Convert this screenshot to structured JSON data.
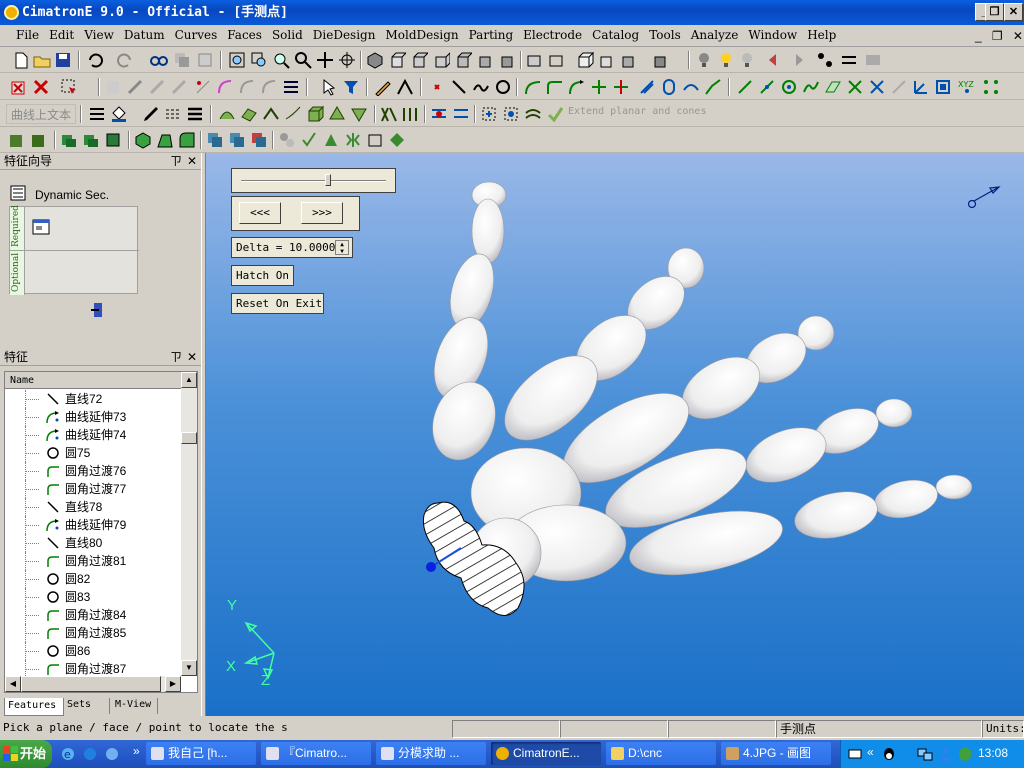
{
  "window": {
    "title": "CimatronE 9.0 - Official - [手测点]",
    "controls": [
      "_",
      "❐",
      "✕"
    ],
    "doc_controls": [
      "_",
      "❐",
      "✕"
    ]
  },
  "menu": [
    "File",
    "Edit",
    "View",
    "Datum",
    "Curves",
    "Faces",
    "Solid",
    "DieDesign",
    "MoldDesign",
    "Parting",
    "Electrode",
    "Catalog",
    "Tools",
    "Analyze",
    "Window",
    "Help"
  ],
  "toolbar3": {
    "text_button": "曲线上文本",
    "disabled_label": "Extend planar and cones"
  },
  "feature_guide": {
    "header": "特征向导",
    "pin": "ㄗ",
    "close": "✕",
    "title": "Dynamic Sec.",
    "required": "Required",
    "optional": "Optional"
  },
  "features_panel": {
    "header": "特征",
    "pin": "ㄗ",
    "close": "✕",
    "column": "Name",
    "items": [
      {
        "icon": "line",
        "label": "直线72"
      },
      {
        "icon": "extend",
        "label": "曲线延伸73"
      },
      {
        "icon": "extend",
        "label": "曲线延伸74"
      },
      {
        "icon": "circle",
        "label": "圆75"
      },
      {
        "icon": "fillet",
        "label": "圆角过渡76"
      },
      {
        "icon": "fillet",
        "label": "圆角过渡77"
      },
      {
        "icon": "line",
        "label": "直线78"
      },
      {
        "icon": "extend",
        "label": "曲线延伸79"
      },
      {
        "icon": "line",
        "label": "直线80"
      },
      {
        "icon": "fillet",
        "label": "圆角过渡81"
      },
      {
        "icon": "circle",
        "label": "圆82"
      },
      {
        "icon": "circle",
        "label": "圆83"
      },
      {
        "icon": "fillet",
        "label": "圆角过渡84"
      },
      {
        "icon": "fillet",
        "label": "圆角过渡85"
      },
      {
        "icon": "circle",
        "label": "圆86"
      },
      {
        "icon": "fillet",
        "label": "圆角过渡87"
      }
    ],
    "tabs": [
      "Features",
      "Sets",
      "M-View"
    ]
  },
  "dynamic_section": {
    "prev": "<<<",
    "next": ">>>",
    "delta": "Delta = 10.0000",
    "hatch": "Hatch On",
    "reset": "Reset On Exit",
    "slider_value": 0.6
  },
  "axes": {
    "x": "X",
    "y": "Y",
    "z": "Z"
  },
  "status": {
    "prompt": "Pick a plane / face / point to locate the s",
    "doc": "手测点",
    "units": "Units:"
  },
  "taskbar": {
    "start": "开始",
    "quick_more": "»",
    "tasks": [
      "我自己 [h...",
      "『Cimatro...",
      "分模求助 ...",
      "CimatronE...",
      "D:\\cnc",
      "4.JPG - 画图"
    ],
    "tray_more": "«",
    "clock": "13:08"
  },
  "colors": {
    "titlebar": "#0a5fe0",
    "viewport_top": "#9ab8e8",
    "viewport_bottom": "#1a70c8",
    "taskbar": "#2458c8",
    "start": "#3c9a3c"
  }
}
